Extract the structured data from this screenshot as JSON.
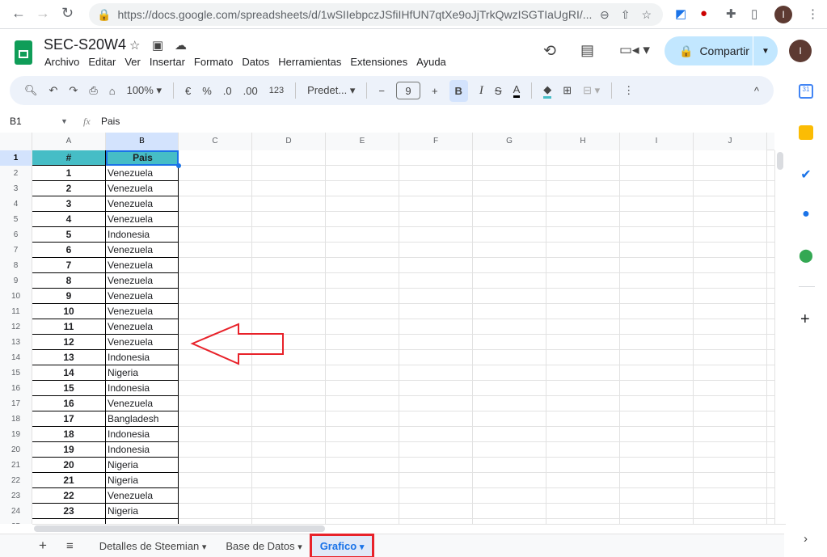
{
  "browser": {
    "url": "https://docs.google.com/spreadsheets/d/1wSIIebpczJSfiIHfUN7qtXe9oJjTrkQwzISGTIaUgRI/...",
    "avatar": "I"
  },
  "doc": {
    "title": "SEC-S20W4",
    "avatar": "I",
    "share_label": "Compartir",
    "menu": [
      "Archivo",
      "Editar",
      "Ver",
      "Insertar",
      "Formato",
      "Datos",
      "Herramientas",
      "Extensiones",
      "Ayuda"
    ]
  },
  "toolbar": {
    "zoom": "100%",
    "currency": "€",
    "percent": "%",
    "dec_less": ".0",
    "dec_more": ".00",
    "format": "123",
    "font": "Predet...",
    "font_size": "9",
    "bold": "B",
    "italic": "I",
    "strike": "S",
    "text_color": "A"
  },
  "formula_bar": {
    "cell_ref": "B1",
    "fx": "fx",
    "value": "Pais"
  },
  "columns": [
    "A",
    "B",
    "C",
    "D",
    "E",
    "F",
    "G",
    "H",
    "I",
    "J"
  ],
  "header_row": {
    "a": "#",
    "b": "Pais"
  },
  "rows": [
    {
      "n": "1",
      "c": "Venezuela"
    },
    {
      "n": "2",
      "c": "Venezuela"
    },
    {
      "n": "3",
      "c": "Venezuela"
    },
    {
      "n": "4",
      "c": "Venezuela"
    },
    {
      "n": "5",
      "c": "Indonesia"
    },
    {
      "n": "6",
      "c": "Venezuela"
    },
    {
      "n": "7",
      "c": "Venezuela"
    },
    {
      "n": "8",
      "c": "Venezuela"
    },
    {
      "n": "9",
      "c": "Venezuela"
    },
    {
      "n": "10",
      "c": "Venezuela"
    },
    {
      "n": "11",
      "c": "Venezuela"
    },
    {
      "n": "12",
      "c": "Venezuela"
    },
    {
      "n": "13",
      "c": "Indonesia"
    },
    {
      "n": "14",
      "c": "Nigeria"
    },
    {
      "n": "15",
      "c": "Indonesia"
    },
    {
      "n": "16",
      "c": "Venezuela"
    },
    {
      "n": "17",
      "c": "Bangladesh"
    },
    {
      "n": "18",
      "c": "Indonesia"
    },
    {
      "n": "19",
      "c": "Indonesia"
    },
    {
      "n": "20",
      "c": "Nigeria"
    },
    {
      "n": "21",
      "c": "Nigeria"
    },
    {
      "n": "22",
      "c": "Venezuela"
    },
    {
      "n": "23",
      "c": "Nigeria"
    }
  ],
  "sheet_tabs": [
    {
      "label": "Detalles de Steemian"
    },
    {
      "label": "Base de Datos"
    },
    {
      "label": "Grafico",
      "active": true
    }
  ],
  "colors": {
    "header_fill": "#46bdc6",
    "active_tab": "#1a73e8",
    "annotation": "#e8222a"
  }
}
